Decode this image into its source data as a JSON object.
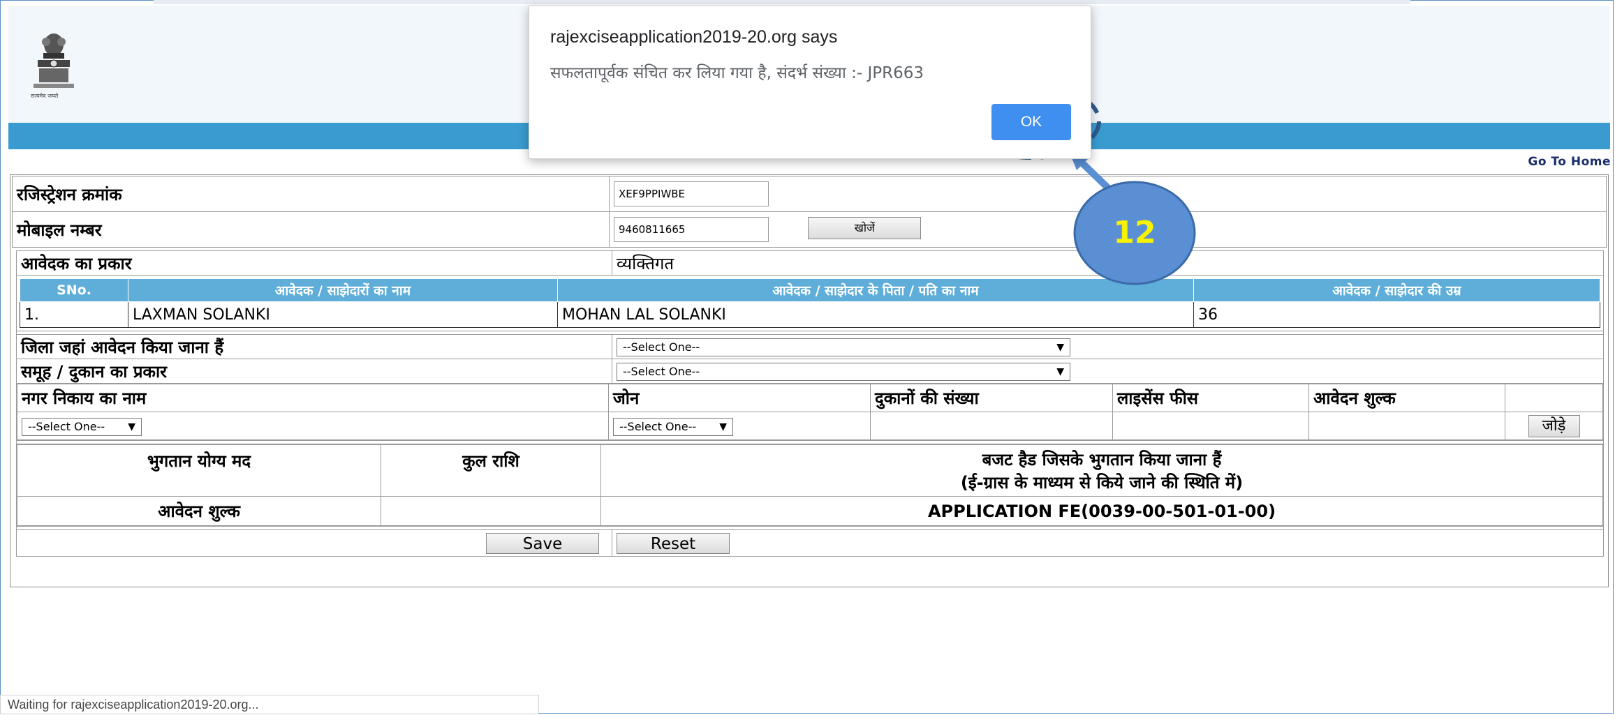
{
  "dialog": {
    "title": "rajexciseapplication2019-20.org says",
    "message": "सफलतापूर्वक संचित कर लिया गया है, संदर्भ संख्या  :- JPR663",
    "ok_label": "OK"
  },
  "annotation": {
    "step_number": "12",
    "callout_color": "#5b8fd4",
    "step_text_color": "#f7f200"
  },
  "header": {
    "go_home": "Go To Home",
    "band_color": "#3a9bd1",
    "emblem_caption": "सत्यमेव जयते"
  },
  "registration": {
    "reg_label": "रजिस्ट्रेशन क्रमांक",
    "reg_value": "XEF9PPIWBE",
    "mobile_label": "मोबाइल नम्बर",
    "mobile_value": "9460811665",
    "search_label": "खोजें"
  },
  "applicant": {
    "type_label": "आवेदक का प्रकार",
    "type_value": "व्यक्तिगत",
    "columns": [
      "SNo.",
      "आवेदक / साझेदारों का नाम",
      "आवेदक / साझेदार के पिता / पति का नाम",
      "आवेदक / साझेदार की उम्र"
    ],
    "rows": [
      {
        "sno": "1.",
        "name": "LAXMAN SOLANKI",
        "father": "MOHAN LAL SOLANKI",
        "age": "36"
      }
    ]
  },
  "district": {
    "label": "जिला जहां आवेदन किया जाना हैं",
    "selected": "--Select One--"
  },
  "shop_type": {
    "label": "समूह / दुकान का प्रकार",
    "selected": "--Select One--"
  },
  "municipal": {
    "columns": [
      "नगर निकाय का नाम",
      "जोन",
      "दुकानों की संख्या",
      "लाइसेंस फीस",
      "आवेदन शुल्क"
    ],
    "body_select": "--Select One--",
    "zone_select": "--Select One--",
    "add_label": "जोड़े"
  },
  "payment": {
    "col1": "भुगतान योग्य मद",
    "col2": "कुल राशि",
    "col3_line1": "बजट हैड जिसके भुगतान किया जाना हैं",
    "col3_line2": "(ई-ग्रास के माध्यम से किये जाने की स्थिति में)",
    "row_label": "आवेदन शुल्क",
    "row_head": "APPLICATION FE(0039-00-501-01-00)"
  },
  "buttons": {
    "save": "Save",
    "reset": "Reset"
  },
  "status_bar": "Waiting for rajexciseapplication2019-20.org..."
}
